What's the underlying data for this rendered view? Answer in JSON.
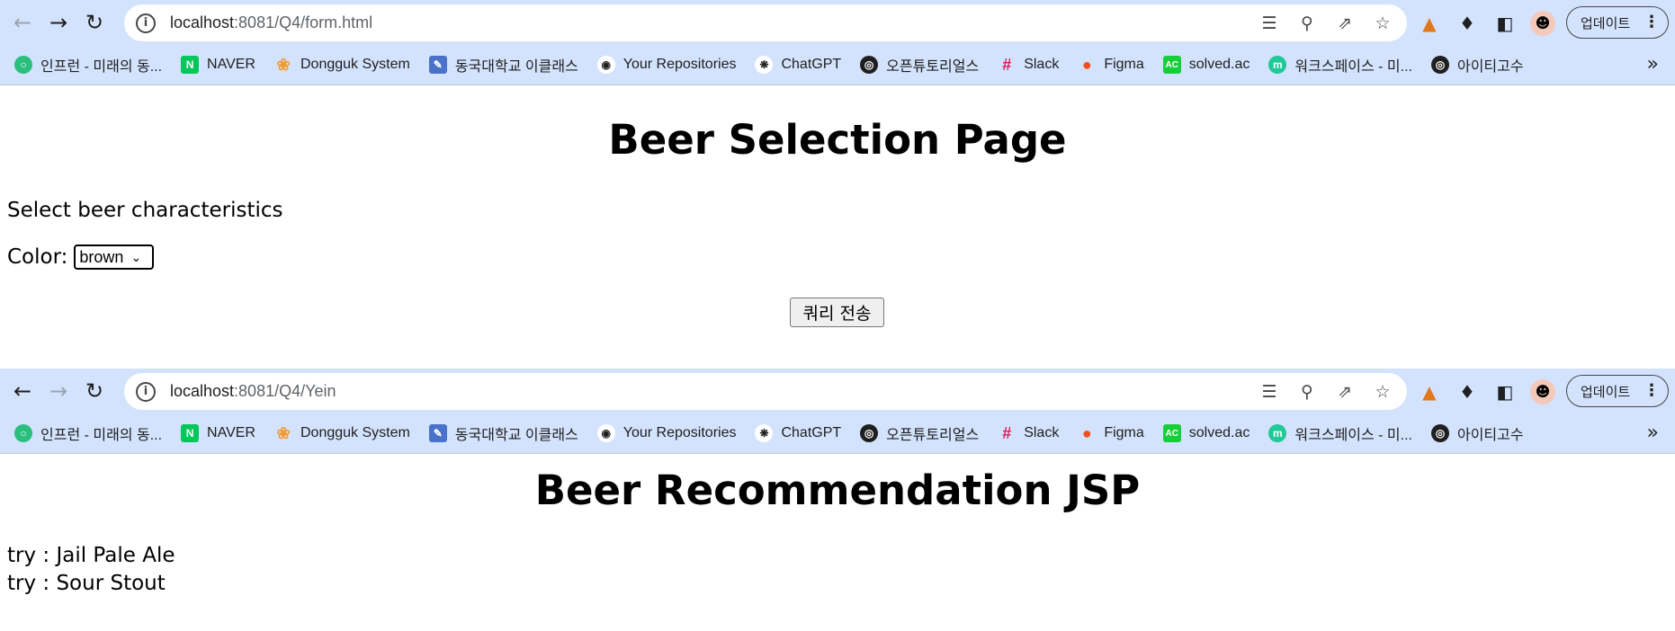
{
  "window1": {
    "url_host": "localhost",
    "url_path": ":8081/Q4/form.html",
    "page": {
      "title": "Beer Selection Page",
      "subtitle": "Select beer characteristics",
      "color_label": "Color:",
      "color_selected": "brown",
      "submit_label": "쿼리 전송"
    }
  },
  "window2": {
    "url_host": "localhost",
    "url_path": ":8081/Q4/Yein",
    "page": {
      "title": "Beer Recommendation JSP",
      "recommendations": [
        "try : Jail Pale Ale",
        "try : Sour Stout"
      ]
    }
  },
  "browser": {
    "update_label": "업데이트",
    "bookmarks": [
      {
        "label": "인프런 - 미래의 동...",
        "icon": "inflearn-icon",
        "color": "#2bbf7e"
      },
      {
        "label": "NAVER",
        "icon": "naver-icon",
        "color": "#03c75a"
      },
      {
        "label": "Dongguk System",
        "icon": "dongguk-icon",
        "color": "#f29b30"
      },
      {
        "label": "동국대학교 이클래스",
        "icon": "eclass-icon",
        "color": "#4a72c9"
      },
      {
        "label": "Your Repositories",
        "icon": "github-icon",
        "color": "#ffffff"
      },
      {
        "label": "ChatGPT",
        "icon": "chatgpt-icon",
        "color": "#ffffff"
      },
      {
        "label": "오픈튜토리얼스",
        "icon": "globe-icon",
        "color": "#1f1f1f"
      },
      {
        "label": "Slack",
        "icon": "slack-icon",
        "color": "#e01e5a"
      },
      {
        "label": "Figma",
        "icon": "figma-icon",
        "color": "#f24e1e"
      },
      {
        "label": "solved.ac",
        "icon": "solvedac-icon",
        "color": "#17ce3a"
      },
      {
        "label": "워크스페이스 - 미...",
        "icon": "workspace-icon",
        "color": "#20c997"
      },
      {
        "label": "아이티고수",
        "icon": "globe-icon",
        "color": "#1f1f1f"
      }
    ]
  }
}
